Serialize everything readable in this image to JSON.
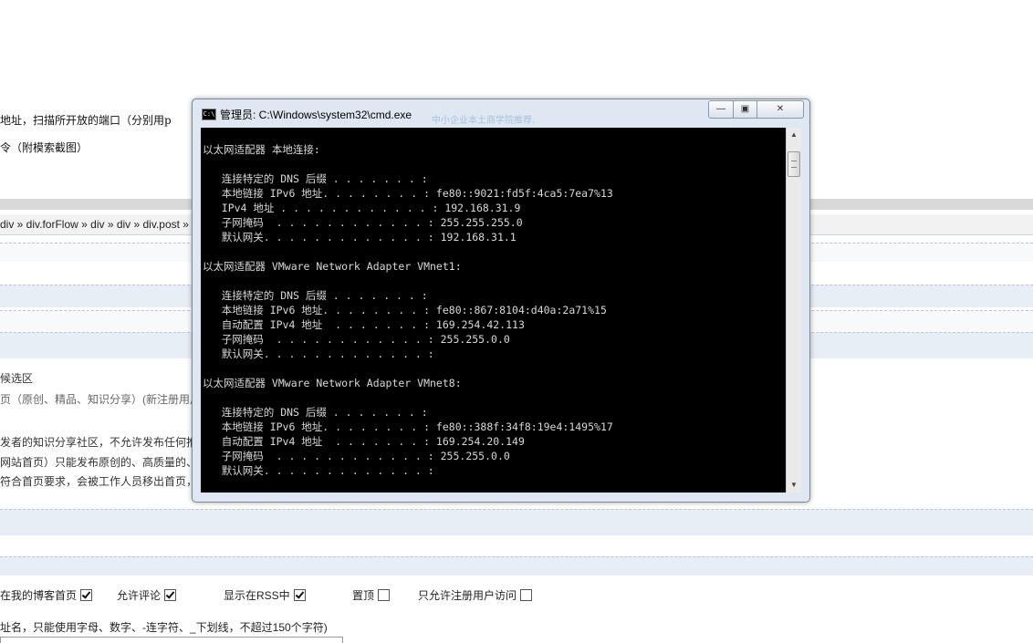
{
  "background_page": {
    "text_line_1": "地址，扫描所开放的端口（分别用p",
    "text_line_2": "令（附模索截图）",
    "breadcrumb": "div » div.forFlow » div » div » div.post »",
    "section_title": "候选区",
    "section_line_1": "页（原创、精品、知识分享）(新注册用户",
    "section_line_2": "发者的知识分享社区，不允许发布任何推",
    "section_line_3": "网站首页）只能发布原创的、高质量的、",
    "section_line_4": "符合首页要求，会被工作人员移出首页，",
    "options": [
      {
        "label": "在我的博客首页",
        "checked": true
      },
      {
        "label": "允许评论",
        "checked": true
      },
      {
        "label": "显示在RSS中",
        "checked": true
      },
      {
        "label": "置顶",
        "checked": false
      },
      {
        "label": "只允许注册用户访问",
        "checked": false
      }
    ],
    "url_hint": "址名，只能使用字母、数字、-连字符、_下划线，不超过150个字符)"
  },
  "cmd_window": {
    "title": "管理员: C:\\Windows\\system32\\cmd.exe",
    "icon_label": "C:\\",
    "title_ghost": "中小企业本土商学院推荐.",
    "buttons": {
      "minimize": "—",
      "maximize": "▣",
      "close": "✕"
    },
    "lines": [
      "",
      "以太网适配器 本地连接:",
      "",
      "   连接特定的 DNS 后缀 . . . . . . . :",
      "   本地链接 IPv6 地址. . . . . . . . : fe80::9021:fd5f:4ca5:7ea7%13",
      "   IPv4 地址 . . . . . . . . . . . . : 192.168.31.9",
      "   子网掩码  . . . . . . . . . . . . : 255.255.255.0",
      "   默认网关. . . . . . . . . . . . . : 192.168.31.1",
      "",
      "以太网适配器 VMware Network Adapter VMnet1:",
      "",
      "   连接特定的 DNS 后缀 . . . . . . . :",
      "   本地链接 IPv6 地址. . . . . . . . : fe80::867:8104:d40a:2a71%15",
      "   自动配置 IPv4 地址  . . . . . . . : 169.254.42.113",
      "   子网掩码  . . . . . . . . . . . . : 255.255.0.0",
      "   默认网关. . . . . . . . . . . . . :",
      "",
      "以太网适配器 VMware Network Adapter VMnet8:",
      "",
      "   连接特定的 DNS 后缀 . . . . . . . :",
      "   本地链接 IPv6 地址. . . . . . . . : fe80::388f:34f8:19e4:1495%17",
      "   自动配置 IPv4 地址  . . . . . . . : 169.254.20.149",
      "   子网掩码  . . . . . . . . . . . . : 255.255.0.0",
      "   默认网关. . . . . . . . . . . . . :"
    ],
    "scrollbar": {
      "up": "▲",
      "down": "▼"
    }
  }
}
